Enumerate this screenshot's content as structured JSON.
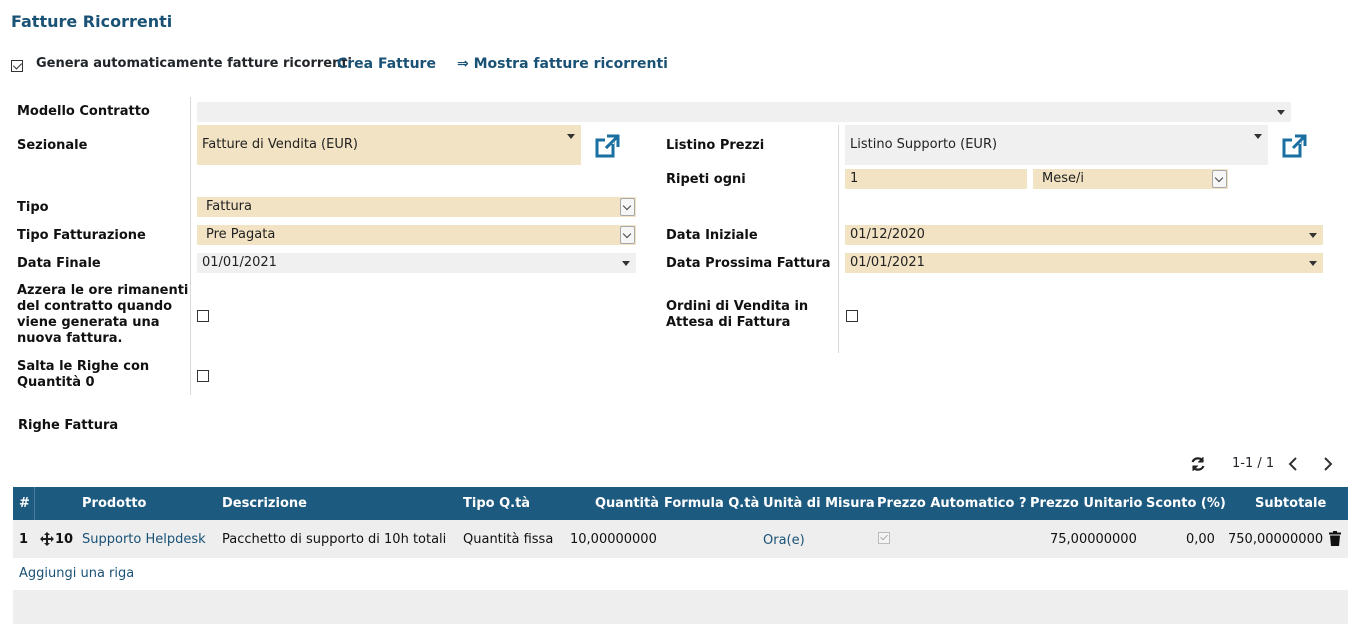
{
  "title": "Fatture Ricorrenti",
  "top": {
    "auto_label": "Genera automaticamente fatture ricorrenti",
    "auto_checked": true,
    "create_link": "Crea Fatture",
    "show_link": "⇒ Mostra fatture ricorrenti"
  },
  "form": {
    "modello": {
      "label": "Modello Contratto",
      "value": ""
    },
    "sezionale": {
      "label": "Sezionale",
      "value": "Fatture di Vendita (EUR)"
    },
    "listino": {
      "label": "Listino Prezzi",
      "value": "Listino Supporto (EUR)"
    },
    "ripeti": {
      "label": "Ripeti ogni",
      "value": "1",
      "unit": "Mese/i"
    },
    "tipo": {
      "label": "Tipo",
      "value": "Fattura"
    },
    "tipo_fatturazione": {
      "label": "Tipo Fatturazione",
      "value": "Pre Pagata"
    },
    "data_iniziale": {
      "label": "Data Iniziale",
      "value": "01/12/2020"
    },
    "data_finale": {
      "label": "Data Finale",
      "value": "01/01/2021"
    },
    "data_prossima": {
      "label": "Data Prossima Fattura",
      "value": "01/01/2021"
    },
    "azzera": {
      "label_lines": [
        "Azzera le ore rimanenti",
        "del contratto quando",
        "viene generata una",
        "nuova fattura."
      ],
      "checked": false
    },
    "ordini": {
      "label_lines": [
        "Ordini di Vendita in",
        "Attesa di Fattura"
      ],
      "checked": false
    },
    "salta": {
      "label_lines": [
        "Salta le Righe con",
        "Quantità 0"
      ],
      "checked": false
    }
  },
  "righe": {
    "title": "Righe Fattura",
    "pager": "1-1 / 1",
    "columns": [
      "#",
      "Prodotto",
      "Descrizione",
      "Tipo Q.tà",
      "Quantità",
      "Formula Q.tà",
      "Unità di Misura",
      "Prezzo Automatico ?",
      "Prezzo Unitario",
      "Sconto (%)",
      "Subtotale"
    ],
    "rows": [
      {
        "num": "1",
        "seq": "10",
        "prodotto": "Supporto Helpdesk",
        "descrizione": "Pacchetto di supporto di 10h totali",
        "tipo_qta": "Quantità fissa",
        "quantita": "10,00000000",
        "formula": "",
        "uom": "Ora(e)",
        "prezzo_auto": true,
        "prezzo_unitario": "75,00000000",
        "sconto": "0,00",
        "subtotale": "750,00000000"
      }
    ],
    "add_line": "Aggiungi una riga"
  },
  "colors": {
    "accent": "#1a5276",
    "header_bg": "#1d5a80",
    "required_bg": "#f2e3c4",
    "field_bg": "#f0f0f0"
  }
}
